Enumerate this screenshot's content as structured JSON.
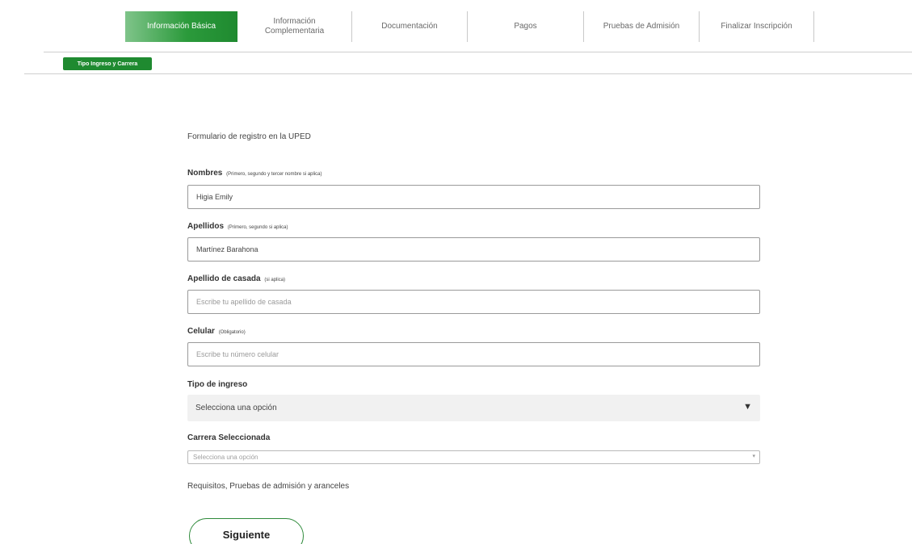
{
  "tabs": [
    {
      "label": "Información Básica",
      "active": true
    },
    {
      "label_line1": "Información",
      "label_line2": "Complementaria",
      "active": false
    },
    {
      "label": "Documentación",
      "active": false
    },
    {
      "label": "Pagos",
      "active": false
    },
    {
      "label": "Pruebas de Admisión",
      "active": false
    },
    {
      "label": "Finalizar Inscripción",
      "active": false
    }
  ],
  "subtab": {
    "label": "Tipo Ingreso y Carrera"
  },
  "form": {
    "title": "Formulario de registro en la UPED",
    "nombres": {
      "label": "Nombres",
      "hint": "(Primero, segundo y tercer nombre si aplica)",
      "value": "Higia Emily"
    },
    "apellidos": {
      "label": "Apellidos",
      "hint": "(Primero, segundo si aplica)",
      "value": "Martínez Barahona"
    },
    "casada": {
      "label": "Apellido de casada",
      "hint": "(si aplica)",
      "placeholder": "Escribe tu apellido de casada"
    },
    "celular": {
      "label": "Celular",
      "hint": "(Obligatorio)",
      "placeholder": "Escribe tu número celular"
    },
    "tipo_ingreso": {
      "label": "Tipo de ingreso",
      "selected": "Selecciona una opción"
    },
    "carrera": {
      "label": "Carrera Seleccionada",
      "selected": "Selecciona una opción"
    },
    "requirements_text": "Requisitos, Pruebas de admisión y aranceles",
    "next_label": "Siguiente"
  },
  "colors": {
    "accent": "#1f8a30",
    "tab_gradient_start": "#7fc48a"
  },
  "icons": {
    "select_arrow": "caret-down-icon"
  }
}
